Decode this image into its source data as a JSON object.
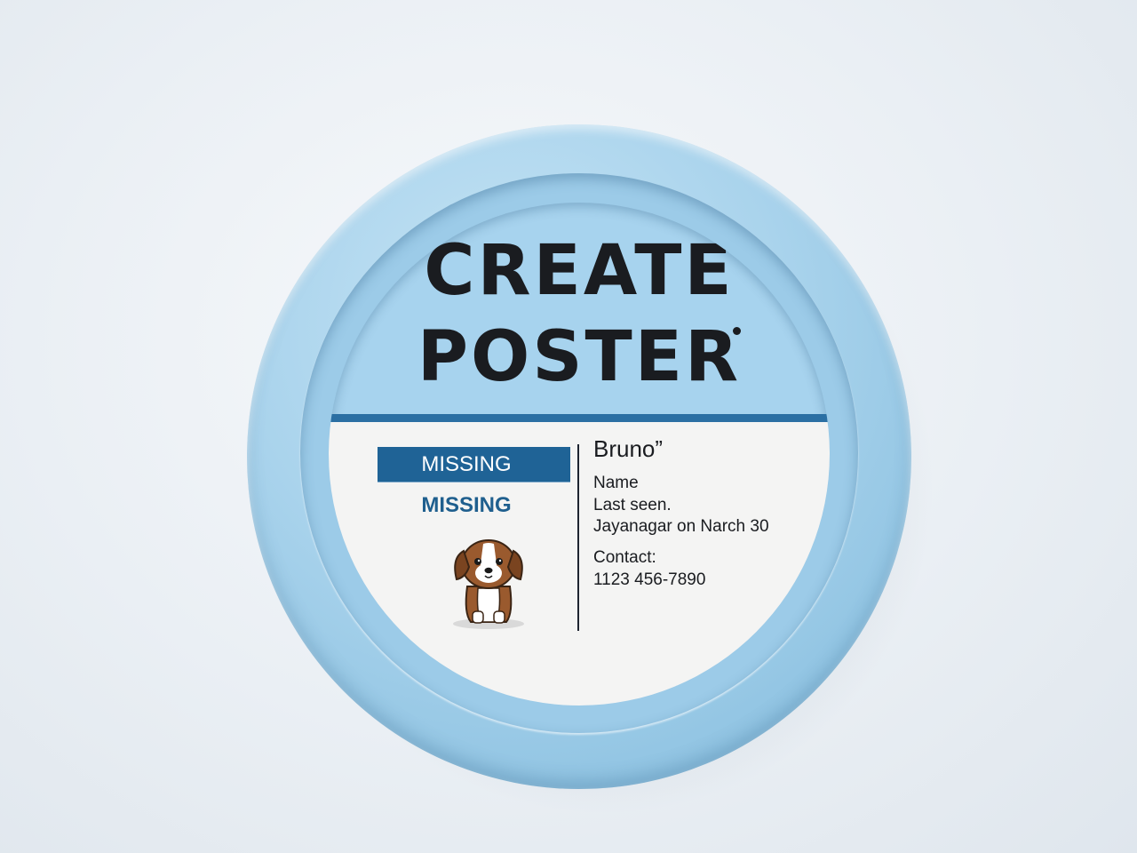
{
  "button": {
    "title_line1": "CREATE",
    "title_line2": "POSTER"
  },
  "poster": {
    "banner_label": "MISSING",
    "sub_label": "MISSING",
    "pet_name": "Bruno”",
    "name_label": "Name",
    "last_seen_label": "Last seen.",
    "last_seen_value": "Jayanagar on Narch 30",
    "contact_label": "Contact:",
    "contact_value": "1123 456-7890",
    "illustration": "puppy-icon"
  },
  "colors": {
    "ring": "#a9d3ec",
    "face": "#a7d3ee",
    "accent": "#1f6396",
    "text": "#1a1c20",
    "card": "#f4f4f3"
  }
}
